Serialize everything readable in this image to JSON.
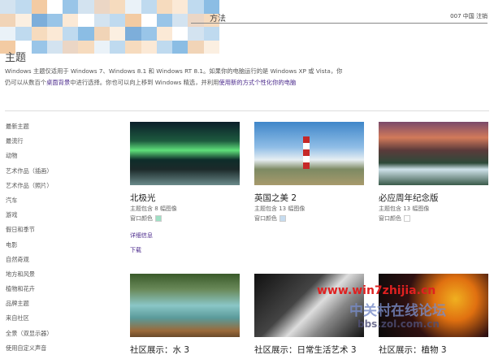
{
  "header": {
    "title_fragment": "方法",
    "account": "007 中国",
    "signout": "注销"
  },
  "page": {
    "heading": "主题",
    "para1": "Windows 主题仅适用于 Windows 7、Windows 8.1 和 Windows RT 8.1。如果你的电脑运行的是 Windows XP 或 Vista，你",
    "para2a": "仍可以从数百个",
    "link1": "桌面背景",
    "para2b": "中进行选择。你也可以向上移到 Windows 精选，并利用",
    "link2": "使用新的方式个性化你的电脑"
  },
  "sidebar": {
    "items": [
      "最新主题",
      "最流行",
      "动物",
      "艺术作品（插画）",
      "艺术作品（照片）",
      "汽车",
      "游戏",
      "假日和季节",
      "电影",
      "自然奇观",
      "地方和风景",
      "植物和花卉",
      "品牌主题",
      "来自社区",
      "全景（双显示器）",
      "使用自定义声音"
    ]
  },
  "cards": [
    {
      "title": "北极光",
      "count": "主题包含 8 幅图像",
      "color_label": "窗口颜色",
      "swatch": "#9fe0c4"
    },
    {
      "title": "英国之美 2",
      "count": "主题包含 13 幅图像",
      "color_label": "窗口颜色",
      "swatch": "#c6dcf0"
    },
    {
      "title": "必应周年纪念版",
      "count": "主题包含 13 幅图像",
      "color_label": "窗口颜色",
      "swatch": "#ffffff"
    },
    {
      "title": "社区展示：水 3"
    },
    {
      "title": "社区展示：日常生活艺术 3"
    },
    {
      "title": "社区展示：植物 3"
    }
  ],
  "links": {
    "details": "详细信息",
    "download": "下载"
  },
  "watermark": {
    "url": "www.win7zhijia.cn",
    "forum": "中关村在线论坛",
    "forum_url": "bbs.zol.com.cn"
  }
}
